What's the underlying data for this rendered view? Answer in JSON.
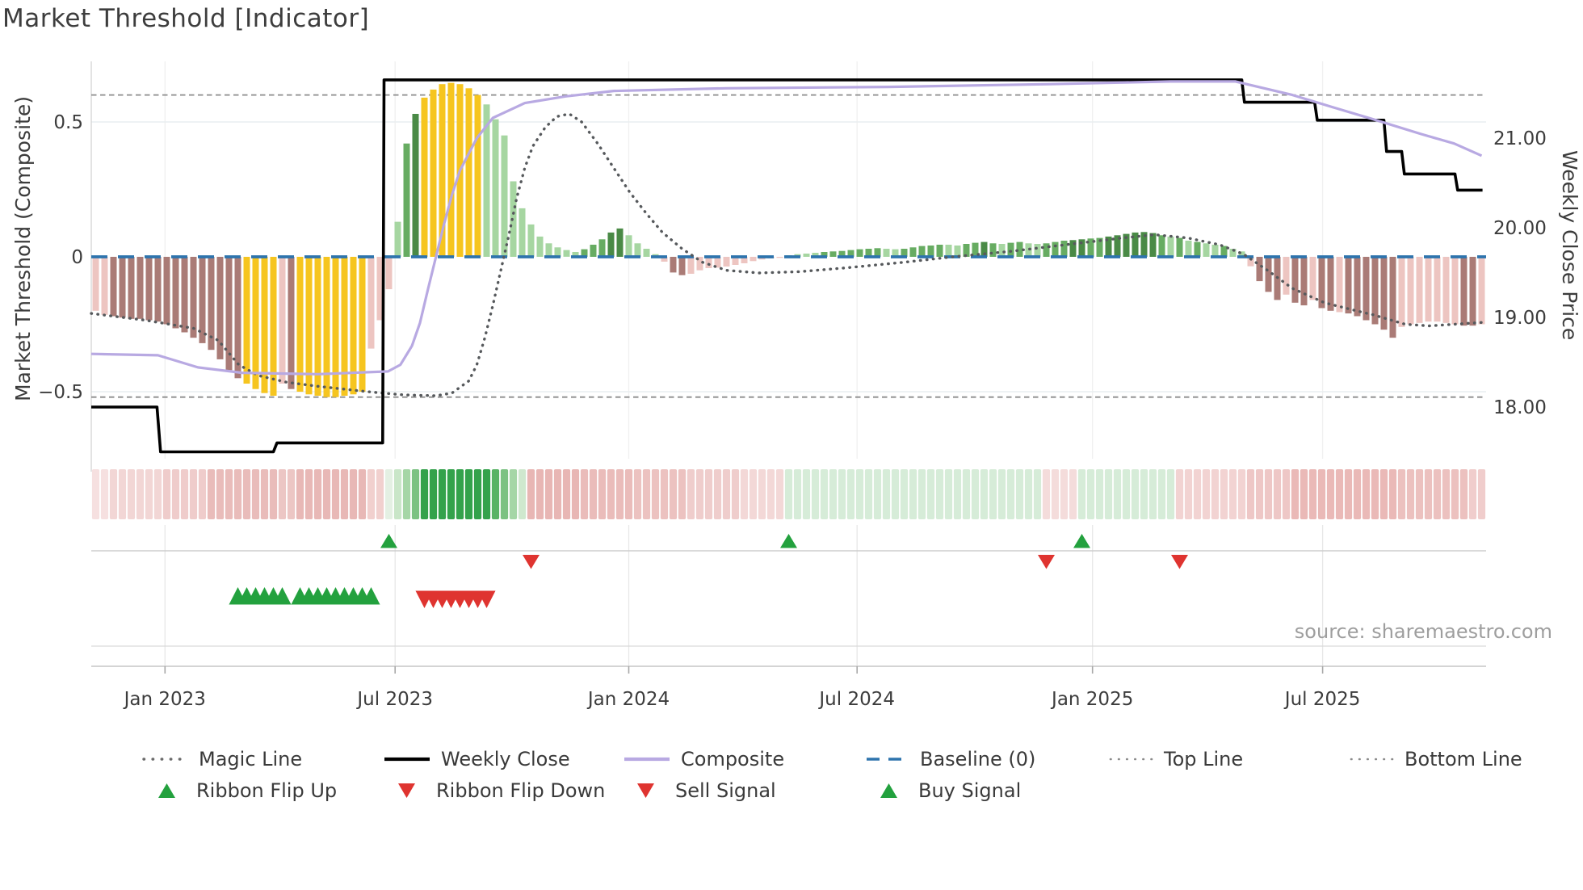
{
  "title": "Market Threshold [Indicator]",
  "left_axis_title": "Market Threshold (Composite)",
  "right_axis_title": "Weekly Close Price",
  "source": "source: sharemaestro.com",
  "legend": {
    "row1": [
      {
        "label": "Magic Line",
        "type": "dotted-gray"
      },
      {
        "label": "Weekly Close",
        "type": "solid-black"
      },
      {
        "label": "Composite",
        "type": "solid-purple"
      },
      {
        "label": "Baseline (0)",
        "type": "dashed-blue"
      },
      {
        "label": "Top Line",
        "type": "dotted-small"
      },
      {
        "label": "Bottom Line",
        "type": "dotted-small"
      }
    ],
    "row2": [
      {
        "label": "Ribbon Flip Up",
        "marker": "triangle-up-green"
      },
      {
        "label": "Ribbon Flip Down",
        "marker": "triangle-down-red"
      },
      {
        "label": "Sell Signal",
        "marker": "triangle-down-red"
      },
      {
        "label": "Buy Signal",
        "marker": "triangle-up-green"
      }
    ]
  },
  "colors": {
    "signal_green": "#23a13e",
    "signal_red": "#df3430",
    "baseline_blue": "#2e74ad",
    "composite_purple": "#b8a9e2",
    "weekly_close_black": "#000000",
    "magic_gray": "#56595c",
    "threshold_gray": "#8c8c8c"
  },
  "chart_data": {
    "type": "combo-bar-line",
    "title": "Market Threshold [Indicator]",
    "weeks": 157,
    "y_left": {
      "label": "Market Threshold (Composite)",
      "tick_labels": [
        "0.5",
        "0",
        "−0.5"
      ],
      "tick_values": [
        0.5,
        0,
        -0.5
      ],
      "range": [
        -0.73,
        0.76
      ]
    },
    "y_right": {
      "label": "Weekly Close Price",
      "tick_labels": [
        "21.00",
        "20.00",
        "19.00",
        "18.00"
      ],
      "tick_values": [
        21,
        20,
        19,
        18
      ]
    },
    "x_ticks": [
      {
        "label": "Jan 2023",
        "week": 7.8
      },
      {
        "label": "Jul 2023",
        "week": 33.7
      },
      {
        "label": "Jan 2024",
        "week": 60.0
      },
      {
        "label": "Jul 2024",
        "week": 85.7
      },
      {
        "label": "Jan 2025",
        "week": 112.2
      },
      {
        "label": "Jul 2025",
        "week": 138.1
      }
    ],
    "baseline": 0,
    "top_line": 0.6,
    "bottom_line": -0.52,
    "histogram": {
      "values": [
        -0.2,
        -0.215,
        -0.22,
        -0.225,
        -0.23,
        -0.23,
        -0.235,
        -0.24,
        -0.25,
        -0.265,
        -0.28,
        -0.3,
        -0.32,
        -0.345,
        -0.38,
        -0.42,
        -0.45,
        -0.47,
        -0.49,
        -0.505,
        -0.515,
        -0.47,
        -0.49,
        -0.5,
        -0.51,
        -0.515,
        -0.52,
        -0.52,
        -0.515,
        -0.51,
        -0.5,
        -0.34,
        -0.235,
        -0.12,
        0.13,
        0.42,
        0.53,
        0.59,
        0.62,
        0.64,
        0.645,
        0.64,
        0.625,
        0.6,
        0.565,
        0.51,
        0.45,
        0.28,
        0.18,
        0.12,
        0.075,
        0.05,
        0.035,
        0.025,
        0.018,
        0.028,
        0.045,
        0.065,
        0.09,
        0.105,
        0.08,
        0.05,
        0.03,
        0.01,
        -0.018,
        -0.058,
        -0.068,
        -0.063,
        -0.05,
        -0.042,
        -0.04,
        -0.036,
        -0.03,
        -0.024,
        -0.016,
        -0.01,
        -0.006,
        -0.004,
        0.006,
        0.01,
        0.012,
        0.015,
        0.018,
        0.02,
        0.022,
        0.025,
        0.028,
        0.03,
        0.032,
        0.03,
        0.028,
        0.03,
        0.035,
        0.04,
        0.042,
        0.045,
        0.045,
        0.042,
        0.048,
        0.052,
        0.055,
        0.05,
        0.048,
        0.052,
        0.055,
        0.05,
        0.048,
        0.05,
        0.055,
        0.06,
        0.062,
        0.065,
        0.068,
        0.07,
        0.075,
        0.08,
        0.085,
        0.09,
        0.092,
        0.088,
        0.08,
        0.075,
        0.07,
        0.06,
        0.055,
        0.05,
        0.045,
        0.04,
        0.03,
        0.02,
        -0.035,
        -0.09,
        -0.13,
        -0.16,
        -0.14,
        -0.17,
        -0.18,
        -0.16,
        -0.19,
        -0.2,
        -0.205,
        -0.21,
        -0.22,
        -0.235,
        -0.25,
        -0.27,
        -0.3,
        -0.26,
        -0.25,
        -0.245,
        -0.24,
        -0.24,
        -0.245,
        -0.25,
        -0.255,
        -0.255,
        -0.25
      ],
      "colors": "PPMMMMMMMMMMMMMMMGGGGPMGGGGGGGGPPPLNDGGGGGGGLLLLLLLLLLLNNNDDLLLLPMMPPPPPPPPPPPLLLLNNNNNNNLLNNNNNLLNNDNLNNLLNNNDDNNDDDDDDNLNLNLLNLLPMMMPMMPMMPMMMMMMPPPPPPPMMP"
    },
    "color_map": {
      "P": "#edc5c1",
      "M": "#aa7b76",
      "G": "#f6c51f",
      "L": "#a6d6a1",
      "N": "#67ac62",
      "D": "#4a8a46"
    },
    "magic_line": [
      [
        -0.5,
        -0.21
      ],
      [
        5.6,
        -0.235
      ],
      [
        11,
        -0.265
      ],
      [
        13.8,
        -0.31
      ],
      [
        16.1,
        -0.4
      ],
      [
        18.3,
        -0.44
      ],
      [
        21.5,
        -0.465
      ],
      [
        25,
        -0.48
      ],
      [
        30.6,
        -0.5
      ],
      [
        34.7,
        -0.512
      ],
      [
        38.3,
        -0.515
      ],
      [
        40.1,
        -0.505
      ],
      [
        42,
        -0.46
      ],
      [
        42.9,
        -0.4
      ],
      [
        43.8,
        -0.3
      ],
      [
        44.7,
        -0.18
      ],
      [
        45.6,
        -0.05
      ],
      [
        46.5,
        0.08
      ],
      [
        47.4,
        0.22
      ],
      [
        48.3,
        0.33
      ],
      [
        49.2,
        0.41
      ],
      [
        50.6,
        0.48
      ],
      [
        51.9,
        0.52
      ],
      [
        53.3,
        0.53
      ],
      [
        54.7,
        0.5
      ],
      [
        56.5,
        0.42
      ],
      [
        58.3,
        0.33
      ],
      [
        60.1,
        0.24
      ],
      [
        62,
        0.16
      ],
      [
        63.8,
        0.09
      ],
      [
        66,
        0.03
      ],
      [
        68.3,
        -0.02
      ],
      [
        71,
        -0.05
      ],
      [
        74.7,
        -0.06
      ],
      [
        79.2,
        -0.055
      ],
      [
        84.7,
        -0.04
      ],
      [
        91,
        -0.02
      ],
      [
        96.5,
        0
      ],
      [
        102.9,
        0.02
      ],
      [
        109.2,
        0.045
      ],
      [
        115.6,
        0.07
      ],
      [
        119.2,
        0.082
      ],
      [
        122.9,
        0.07
      ],
      [
        126.5,
        0.045
      ],
      [
        129.2,
        0.01
      ],
      [
        131.9,
        -0.05
      ],
      [
        134.7,
        -0.117
      ],
      [
        138.3,
        -0.17
      ],
      [
        141.9,
        -0.2
      ],
      [
        143.8,
        -0.215
      ],
      [
        147.4,
        -0.25
      ],
      [
        150.1,
        -0.256
      ],
      [
        152.9,
        -0.25
      ],
      [
        156.1,
        -0.243
      ]
    ],
    "composite_line": [
      [
        -0.5,
        -0.36
      ],
      [
        7,
        -0.365
      ],
      [
        11.5,
        -0.41
      ],
      [
        16.5,
        -0.43
      ],
      [
        25,
        -0.435
      ],
      [
        32.9,
        -0.425
      ],
      [
        34.3,
        -0.4
      ],
      [
        35.6,
        -0.33
      ],
      [
        36.5,
        -0.245
      ],
      [
        37.4,
        -0.12
      ],
      [
        38.3,
        0.0
      ],
      [
        39.2,
        0.12
      ],
      [
        40.1,
        0.23
      ],
      [
        41,
        0.32
      ],
      [
        42.9,
        0.44
      ],
      [
        44.7,
        0.515
      ],
      [
        48.3,
        0.57
      ],
      [
        52.9,
        0.595
      ],
      [
        58.3,
        0.615
      ],
      [
        71,
        0.625
      ],
      [
        89.2,
        0.63
      ],
      [
        107.4,
        0.64
      ],
      [
        121,
        0.65
      ],
      [
        128.3,
        0.65
      ],
      [
        134.7,
        0.6
      ],
      [
        139.2,
        0.555
      ],
      [
        143.8,
        0.51
      ],
      [
        149.2,
        0.455
      ],
      [
        152.9,
        0.42
      ],
      [
        156,
        0.375
      ]
    ],
    "weekly_close": [
      [
        -0.5,
        18.0
      ],
      [
        6.9,
        18.0
      ],
      [
        7.3,
        17.5
      ],
      [
        20,
        17.5
      ],
      [
        20.4,
        17.6
      ],
      [
        32.3,
        17.6
      ],
      [
        32.45,
        21.65
      ],
      [
        129,
        21.65
      ],
      [
        129.3,
        21.4
      ],
      [
        137.2,
        21.4
      ],
      [
        137.5,
        21.2
      ],
      [
        145,
        21.2
      ],
      [
        145.3,
        20.85
      ],
      [
        147,
        20.85
      ],
      [
        147.3,
        20.6
      ],
      [
        153,
        20.6
      ],
      [
        153.3,
        20.42
      ],
      [
        156.1,
        20.42
      ]
    ],
    "ribbon": [
      {
        "from": 0,
        "to": 1,
        "color": "#f6e0e0"
      },
      {
        "from": 2,
        "to": 7,
        "color": "#f2d6d5"
      },
      {
        "from": 8,
        "to": 12,
        "color": "#efcccb"
      },
      {
        "from": 13,
        "to": 20,
        "color": "#e9bcba"
      },
      {
        "from": 21,
        "to": 22,
        "color": "#ecc6c4"
      },
      {
        "from": 23,
        "to": 30,
        "color": "#e8b8b6"
      },
      {
        "from": 31,
        "to": 32,
        "color": "#f1d0ce"
      },
      {
        "from": 33,
        "to": 33,
        "color": "#e4f0e3"
      },
      {
        "from": 34,
        "to": 34,
        "color": "#c9e6c8"
      },
      {
        "from": 35,
        "to": 35,
        "color": "#a5d6a6"
      },
      {
        "from": 36,
        "to": 36,
        "color": "#7cc282"
      },
      {
        "from": 37,
        "to": 44,
        "color": "#34a24b"
      },
      {
        "from": 45,
        "to": 45,
        "color": "#58b364"
      },
      {
        "from": 46,
        "to": 46,
        "color": "#7cc282"
      },
      {
        "from": 47,
        "to": 47,
        "color": "#a5d6a6"
      },
      {
        "from": 48,
        "to": 48,
        "color": "#cfe8ce"
      },
      {
        "from": 49,
        "to": 54,
        "color": "#e8b6b4"
      },
      {
        "from": 55,
        "to": 60,
        "color": "#eabcba"
      },
      {
        "from": 61,
        "to": 66,
        "color": "#ecc2c0"
      },
      {
        "from": 67,
        "to": 72,
        "color": "#efcdcc"
      },
      {
        "from": 73,
        "to": 77,
        "color": "#f3d8d7"
      },
      {
        "from": 78,
        "to": 106,
        "color": "#d6ecd8"
      },
      {
        "from": 107,
        "to": 110,
        "color": "#f4dcdb"
      },
      {
        "from": 111,
        "to": 121,
        "color": "#d6ecd8"
      },
      {
        "from": 122,
        "to": 129,
        "color": "#f2d3d2"
      },
      {
        "from": 130,
        "to": 134,
        "color": "#eec7c6"
      },
      {
        "from": 135,
        "to": 146,
        "color": "#eab9b7"
      },
      {
        "from": 147,
        "to": 154,
        "color": "#ecc1bf"
      },
      {
        "from": 155,
        "to": 156,
        "color": "#f0cdcc"
      }
    ],
    "signals": {
      "buy_weeks": [
        33,
        78,
        111
      ],
      "sell_weeks": [
        49,
        107,
        122
      ],
      "ribbon_flip_up_weeks": [
        [
          16,
          21
        ],
        [
          23,
          31
        ]
      ],
      "ribbon_flip_down_weeks": [
        [
          37,
          44
        ]
      ]
    }
  }
}
